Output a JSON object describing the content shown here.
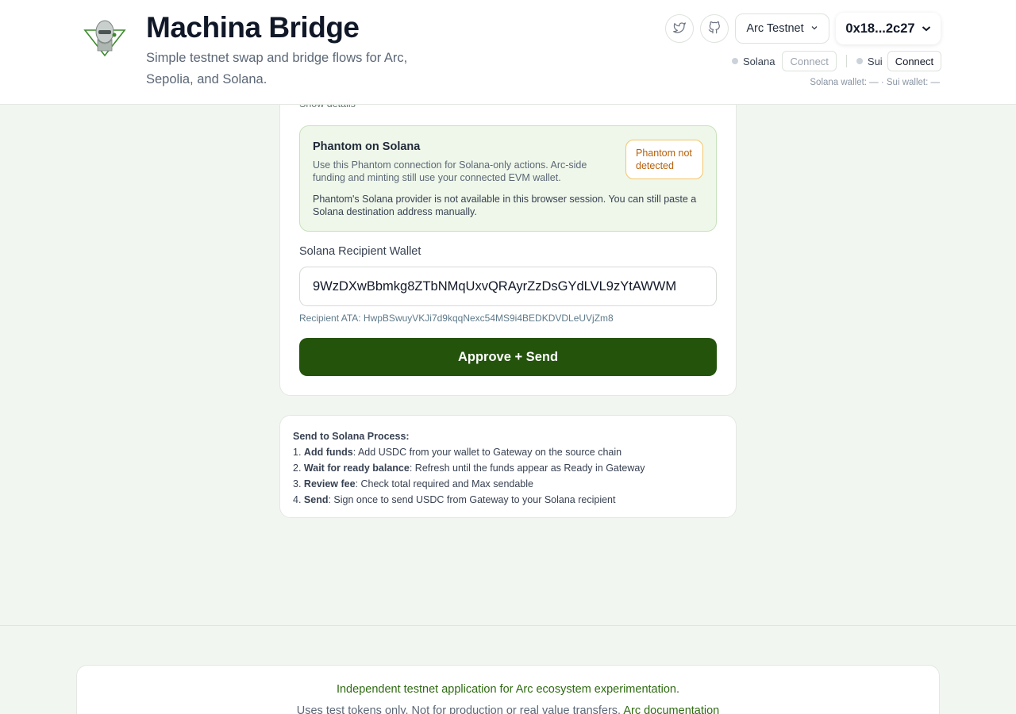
{
  "header": {
    "title": "Machina Bridge",
    "subtitle": "Simple testnet swap and bridge flows for Arc, Sepolia, and Solana.",
    "network": "Arc Testnet",
    "address": "0x18...2c27",
    "icons": [
      "twitter-icon",
      "github-icon",
      "chevron-down-icon"
    ],
    "chains": [
      {
        "name": "Solana",
        "connect_label": "Connect"
      },
      {
        "name": "Sui",
        "connect_label": "Connect"
      }
    ],
    "wallet_status": "Solana wallet: — · Sui wallet: —"
  },
  "card": {
    "show_details": "Show details",
    "phantom": {
      "title": "Phantom on Solana",
      "description": "Use this Phantom connection for Solana-only actions. Arc-side funding and minting still use your connected EVM wallet.",
      "note": "Phantom's Solana provider is not available in this browser session. You can still paste a Solana destination address manually.",
      "badge": "Phantom not detected"
    },
    "recipient_label": "Solana Recipient Wallet",
    "recipient_value": "9WzDXwBbmkg8ZTbNMqUxvQRAyrZzDsGYdLVL9zYtAWWM",
    "ata": "Recipient ATA: HwpBSwuyVKJi7d9kqqNexc54MS9i4BEDKDVDLeUVjZm8",
    "send_label": "Approve + Send"
  },
  "process": {
    "title": "Send to Solana Process:",
    "steps": [
      {
        "num": "1.",
        "bold": "Add funds",
        "text": ": Add USDC from your wallet to Gateway on the source chain"
      },
      {
        "num": "2.",
        "bold": "Wait for ready balance",
        "text": ": Refresh until the funds appear as Ready in Gateway"
      },
      {
        "num": "3.",
        "bold": "Review fee",
        "text": ": Check total required and Max sendable"
      },
      {
        "num": "4.",
        "bold": "Send",
        "text": ": Sign once to send USDC from Gateway to your Solana recipient"
      }
    ]
  },
  "footer": {
    "main": "Independent testnet application for Arc ecosystem experimentation.",
    "sub": "Uses test tokens only. Not for production or real value transfers.",
    "link": "Arc documentation"
  },
  "colors": {
    "primary_button": "#24540c",
    "accent_green": "#2f6b12",
    "phantom_bg": "#eff7ea",
    "badge_warning": "#b5600b",
    "page_bg": "#f2f6f1"
  }
}
